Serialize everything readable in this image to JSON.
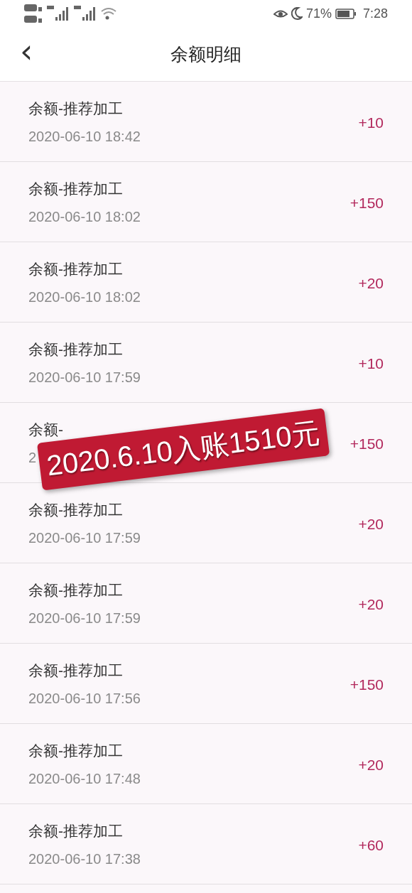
{
  "status_bar": {
    "battery_text": "71%",
    "time": "7:28"
  },
  "header": {
    "title": "余额明细",
    "back_icon": "‹"
  },
  "rows": [
    {
      "title": "余额-推荐加工",
      "date": "2020-06-10 18:42",
      "amount": "+10"
    },
    {
      "title": "余额-推荐加工",
      "date": "2020-06-10 18:02",
      "amount": "+150"
    },
    {
      "title": "余额-推荐加工",
      "date": "2020-06-10 18:02",
      "amount": "+20"
    },
    {
      "title": "余额-推荐加工",
      "date": "2020-06-10 17:59",
      "amount": "+10"
    },
    {
      "title": "余额-",
      "date": "2",
      "amount": "+150"
    },
    {
      "title": "余额-推荐加工",
      "date": "2020-06-10 17:59",
      "amount": "+20"
    },
    {
      "title": "余额-推荐加工",
      "date": "2020-06-10 17:59",
      "amount": "+20"
    },
    {
      "title": "余额-推荐加工",
      "date": "2020-06-10 17:56",
      "amount": "+150"
    },
    {
      "title": "余额-推荐加工",
      "date": "2020-06-10 17:48",
      "amount": "+20"
    },
    {
      "title": "余额-推荐加工",
      "date": "2020-06-10 17:38",
      "amount": "+60"
    }
  ],
  "sticker": {
    "text": "2020.6.10入账1510元"
  }
}
